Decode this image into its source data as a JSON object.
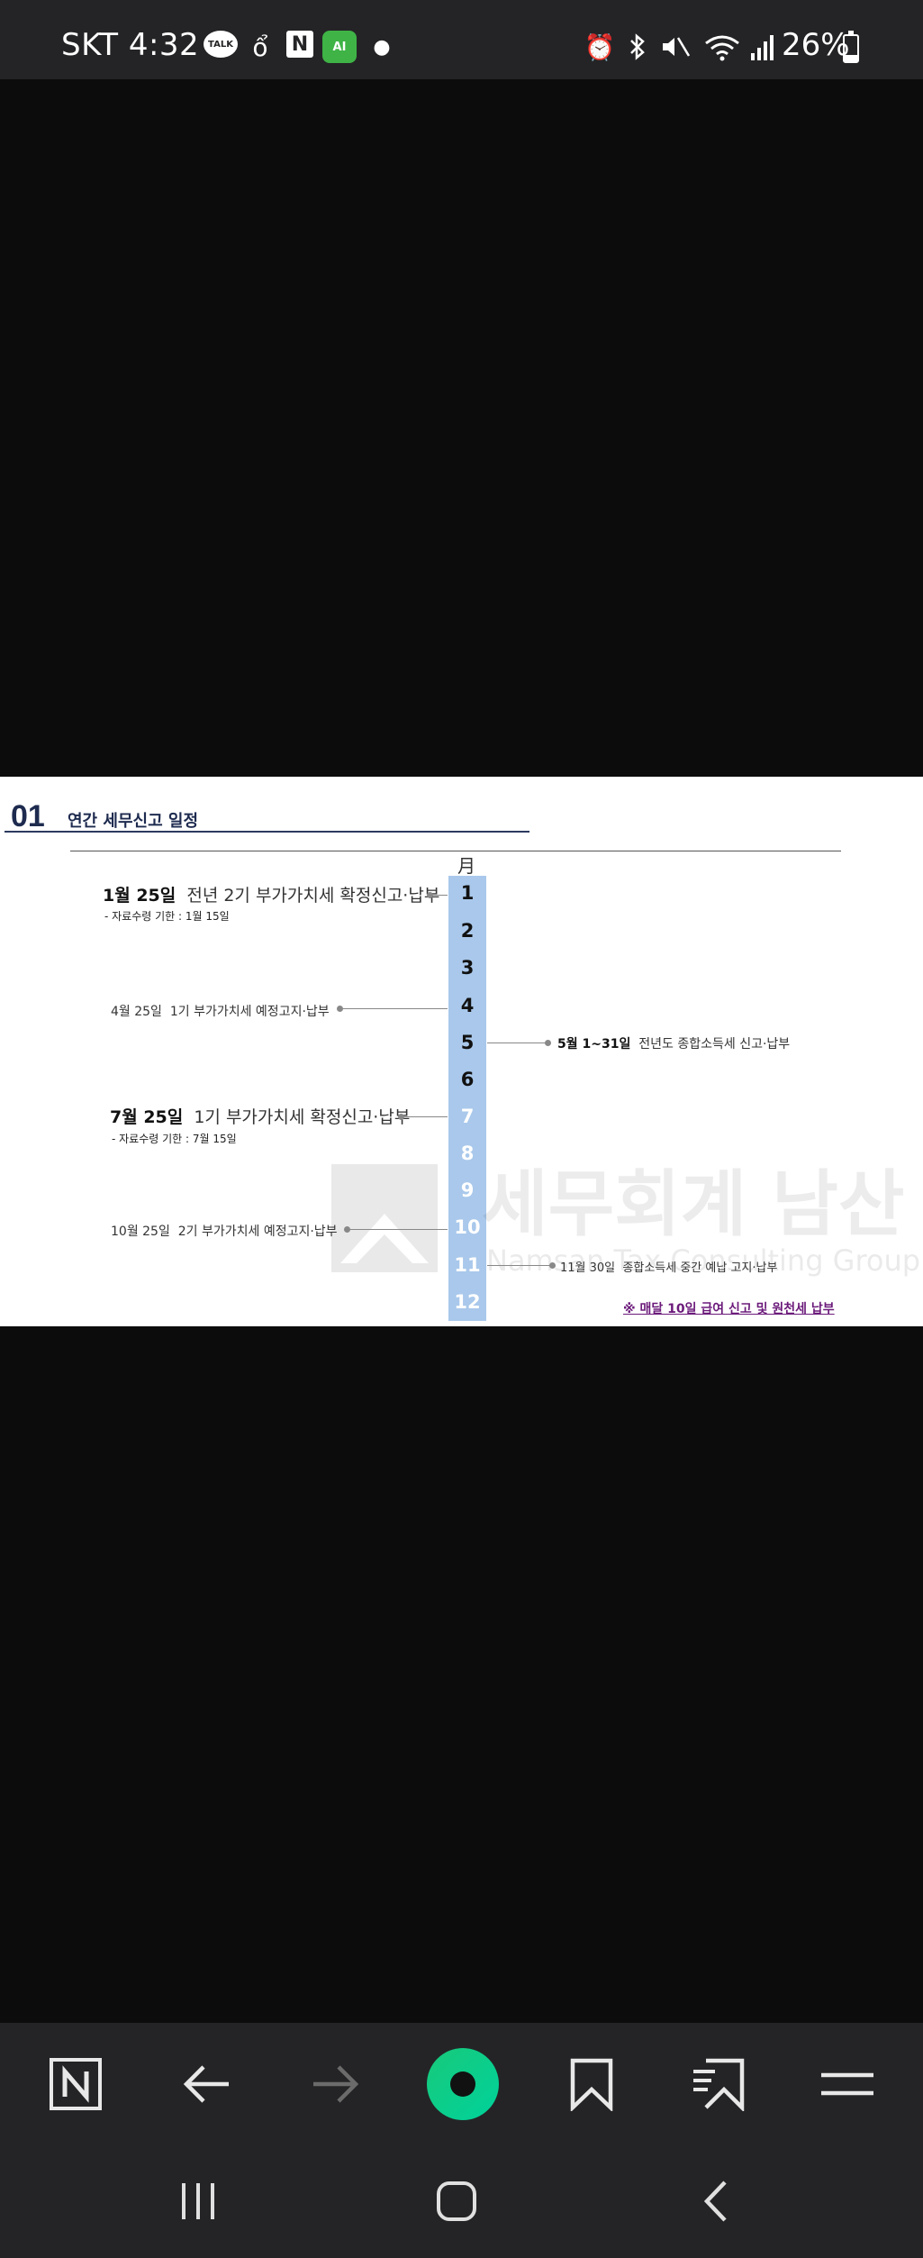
{
  "status_bar": {
    "carrier": "SKT",
    "time": "4:32",
    "talk_label": "TALK",
    "n_label": "N",
    "ai_label": "AI",
    "battery": "26%",
    "battery_level": 0.26,
    "icons": [
      "kakaotalk-icon",
      "drop-icon",
      "naver-icon",
      "ai-app-icon",
      "dot-icon",
      "alarm-icon",
      "bluetooth-icon",
      "mute-icon",
      "wifi-icon",
      "signal-icon",
      "battery-icon"
    ]
  },
  "document": {
    "section_number": "01",
    "section_title": "연간 세무신고 일정",
    "month_header": "月",
    "months": [
      "1",
      "2",
      "3",
      "4",
      "5",
      "6",
      "7",
      "8",
      "9",
      "10",
      "11",
      "12"
    ],
    "events": {
      "jan": {
        "date": "1월 25일",
        "desc": "전년 2기 부가가치세 확정신고·납부",
        "note": "- 자료수령 기한 : 1월 15일"
      },
      "apr": {
        "date": "4월 25일",
        "desc": "1기 부가가치세 예정고지·납부"
      },
      "may": {
        "date": "5월 1~31일",
        "desc": "전년도 종합소득세 신고·납부"
      },
      "jul": {
        "date": "7월 25일",
        "desc": "1기 부가가치세 확정신고·납부",
        "note": "- 자료수령 기한 : 7월 15일"
      },
      "oct": {
        "date": "10월 25일",
        "desc": "2기 부가가치세 예정고지·납부"
      },
      "nov": {
        "date": "11월 30일",
        "desc": "종합소득세 중간 예납 고지·납부"
      }
    },
    "monthly_note": "※ 매달 10일  급여 신고 및 원천세 납부",
    "watermark": "세무회계 남산",
    "watermark_sub": "Namsan Tax Consulting Group"
  },
  "toolbar": {
    "items": [
      "naver-home-icon",
      "back-arrow-icon",
      "forward-arrow-icon",
      "green-dot-icon",
      "bookmark-icon",
      "bookmark-list-icon",
      "menu-icon"
    ]
  },
  "nav_bar": {
    "items": [
      "recent-apps-icon",
      "home-icon",
      "back-icon"
    ]
  },
  "colors": {
    "status_bar_bg": "#242426",
    "month_bar": "#a9c8eb",
    "accent_green": "#1ec96e",
    "section_navy": "#1e2b4f"
  }
}
